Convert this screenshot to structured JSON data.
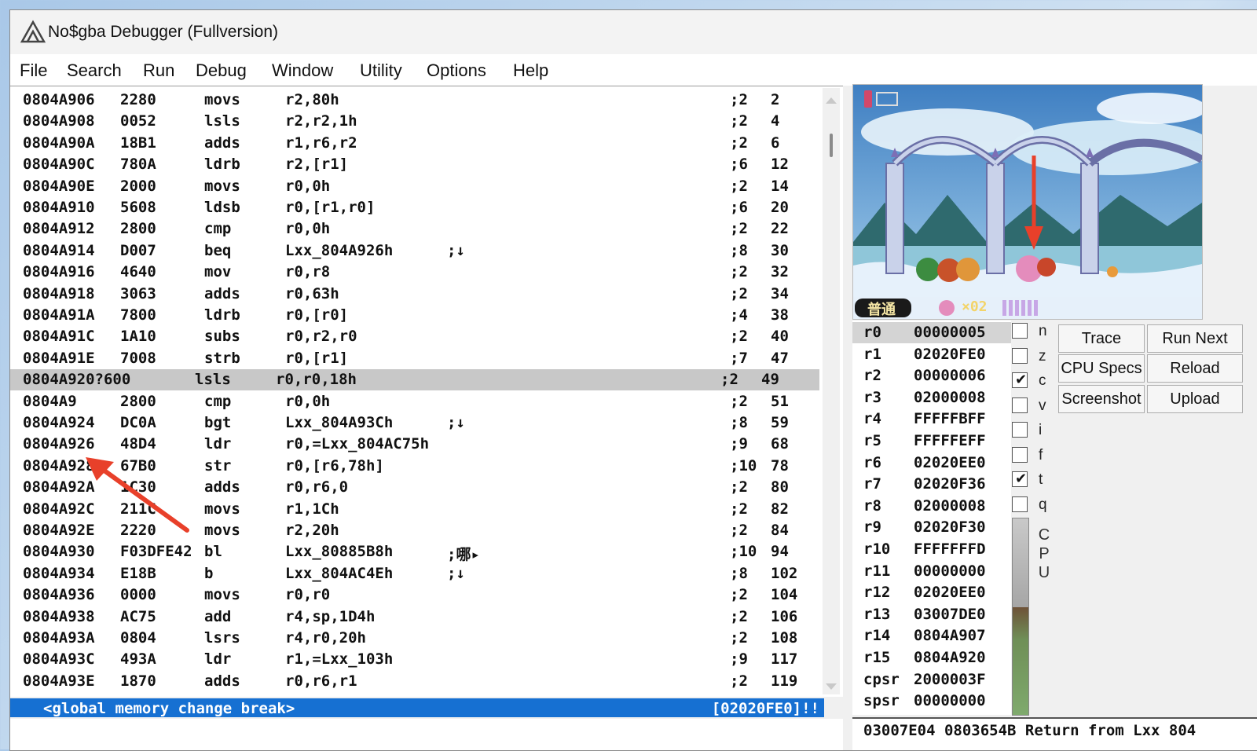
{
  "window": {
    "title": "No$gba Debugger (Fullversion)"
  },
  "menu": [
    "File",
    "Search",
    "Run",
    "Debug",
    "Window",
    "Utility",
    "Options",
    "Help"
  ],
  "disassembly": [
    {
      "addr": "0804A906",
      "op": "2280",
      "mn": "movs",
      "args": "r2,80h",
      "comment": "",
      "cyc": ";2",
      "tot": "2"
    },
    {
      "addr": "0804A908",
      "op": "0052",
      "mn": "lsls",
      "args": "r2,r2,1h",
      "comment": "",
      "cyc": ";2",
      "tot": "4"
    },
    {
      "addr": "0804A90A",
      "op": "18B1",
      "mn": "adds",
      "args": "r1,r6,r2",
      "comment": "",
      "cyc": ";2",
      "tot": "6"
    },
    {
      "addr": "0804A90C",
      "op": "780A",
      "mn": "ldrb",
      "args": "r2,[r1]",
      "comment": "",
      "cyc": ";6",
      "tot": "12"
    },
    {
      "addr": "0804A90E",
      "op": "2000",
      "mn": "movs",
      "args": "r0,0h",
      "comment": "",
      "cyc": ";2",
      "tot": "14"
    },
    {
      "addr": "0804A910",
      "op": "5608",
      "mn": "ldsb",
      "args": "r0,[r1,r0]",
      "comment": "",
      "cyc": ";6",
      "tot": "20"
    },
    {
      "addr": "0804A912",
      "op": "2800",
      "mn": "cmp",
      "args": "r0,0h",
      "comment": "",
      "cyc": ";2",
      "tot": "22"
    },
    {
      "addr": "0804A914",
      "op": "D007",
      "mn": "beq",
      "args": "Lxx_804A926h",
      "comment": ";↓",
      "cyc": ";8",
      "tot": "30"
    },
    {
      "addr": "0804A916",
      "op": "4640",
      "mn": "mov",
      "args": "r0,r8",
      "comment": "",
      "cyc": ";2",
      "tot": "32"
    },
    {
      "addr": "0804A918",
      "op": "3063",
      "mn": "adds",
      "args": "r0,63h",
      "comment": "",
      "cyc": ";2",
      "tot": "34"
    },
    {
      "addr": "0804A91A",
      "op": "7800",
      "mn": "ldrb",
      "args": "r0,[r0]",
      "comment": "",
      "cyc": ";4",
      "tot": "38"
    },
    {
      "addr": "0804A91C",
      "op": "1A10",
      "mn": "subs",
      "args": "r0,r2,r0",
      "comment": "",
      "cyc": ";2",
      "tot": "40"
    },
    {
      "addr": "0804A91E",
      "op": "7008",
      "mn": "strb",
      "args": "r0,[r1]",
      "comment": "",
      "cyc": ";7",
      "tot": "47"
    },
    {
      "addr": "0804A920?600",
      "op": "",
      "mn": "lsls",
      "args": "r0,r0,18h",
      "comment": "",
      "cyc": ";2",
      "tot": "49",
      "selected": true
    },
    {
      "addr": "0804A9",
      "op": "2800",
      "mn": "cmp",
      "args": "r0,0h",
      "comment": "",
      "cyc": ";2",
      "tot": "51"
    },
    {
      "addr": "0804A924",
      "op": "DC0A",
      "mn": "bgt",
      "args": "Lxx_804A93Ch",
      "comment": ";↓",
      "cyc": ";8",
      "tot": "59"
    },
    {
      "addr": "0804A926",
      "op": "48D4",
      "mn": "ldr",
      "args": "r0,=Lxx_804AC75h",
      "comment": "",
      "cyc": ";9",
      "tot": "68"
    },
    {
      "addr": "0804A928",
      "op": "67B0",
      "mn": "str",
      "args": "r0,[r6,78h]",
      "comment": "",
      "cyc": ";10",
      "tot": "78"
    },
    {
      "addr": "0804A92A",
      "op": "1C30",
      "mn": "adds",
      "args": "r0,r6,0",
      "comment": "",
      "cyc": ";2",
      "tot": "80"
    },
    {
      "addr": "0804A92C",
      "op": "211C",
      "mn": "movs",
      "args": "r1,1Ch",
      "comment": "",
      "cyc": ";2",
      "tot": "82"
    },
    {
      "addr": "0804A92E",
      "op": "2220",
      "mn": "movs",
      "args": "r2,20h",
      "comment": "",
      "cyc": ";2",
      "tot": "84"
    },
    {
      "addr": "0804A930",
      "op": "F03DFE42",
      "mn": "bl",
      "args": "Lxx_80885B8h",
      "comment": ";哪▸",
      "cyc": ";10",
      "tot": "94"
    },
    {
      "addr": "0804A934",
      "op": "E18B",
      "mn": "b",
      "args": "Lxx_804AC4Eh",
      "comment": ";↓",
      "cyc": ";8",
      "tot": "102"
    },
    {
      "addr": "0804A936",
      "op": "0000",
      "mn": "movs",
      "args": "r0,r0",
      "comment": "",
      "cyc": ";2",
      "tot": "104"
    },
    {
      "addr": "0804A938",
      "op": "AC75",
      "mn": "add",
      "args": "r4,sp,1D4h",
      "comment": "",
      "cyc": ";2",
      "tot": "106"
    },
    {
      "addr": "0804A93A",
      "op": "0804",
      "mn": "lsrs",
      "args": "r4,r0,20h",
      "comment": "",
      "cyc": ";2",
      "tot": "108"
    },
    {
      "addr": "0804A93C",
      "op": "493A",
      "mn": "ldr",
      "args": "r1,=Lxx_103h",
      "comment": "",
      "cyc": ";9",
      "tot": "117"
    },
    {
      "addr": "0804A93E",
      "op": "1870",
      "mn": "adds",
      "args": "r0,r6,r1",
      "comment": "",
      "cyc": ";2",
      "tot": "119"
    }
  ],
  "status": {
    "message": "<global memory change break>",
    "address": "[02020FE0]!!"
  },
  "game_hud": {
    "mode_label": "普通",
    "lives": "×02"
  },
  "registers": [
    {
      "name": "r0",
      "value": "00000005",
      "selected": true
    },
    {
      "name": "r1",
      "value": "02020FE0"
    },
    {
      "name": "r2",
      "value": "00000006"
    },
    {
      "name": "r3",
      "value": "02000008"
    },
    {
      "name": "r4",
      "value": "FFFFFBFF"
    },
    {
      "name": "r5",
      "value": "FFFFFEFF"
    },
    {
      "name": "r6",
      "value": "02020EE0"
    },
    {
      "name": "r7",
      "value": "02020F36"
    },
    {
      "name": "r8",
      "value": "02000008"
    },
    {
      "name": "r9",
      "value": "02020F30"
    },
    {
      "name": "r10",
      "value": "FFFFFFFD"
    },
    {
      "name": "r11",
      "value": "00000000"
    },
    {
      "name": "r12",
      "value": "02020EE0"
    },
    {
      "name": "r13",
      "value": "03007DE0"
    },
    {
      "name": "r14",
      "value": "0804A907"
    },
    {
      "name": "r15",
      "value": "0804A920"
    },
    {
      "name": "cpsr",
      "value": "2000003F"
    },
    {
      "name": "spsr",
      "value": "00000000"
    }
  ],
  "flags": [
    {
      "name": "n",
      "checked": false
    },
    {
      "name": "z",
      "checked": false
    },
    {
      "name": "c",
      "checked": true
    },
    {
      "name": "v",
      "checked": false
    },
    {
      "name": "i",
      "checked": false
    },
    {
      "name": "f",
      "checked": false
    },
    {
      "name": "t",
      "checked": true
    },
    {
      "name": "q",
      "checked": false
    }
  ],
  "cpu_meter": {
    "label_letters": [
      "C",
      "P",
      "U"
    ],
    "load_fraction": 0.55
  },
  "buttons": {
    "trace": "Trace",
    "run_next": "Run Next",
    "cpu_specs": "CPU Specs",
    "reload": "Reload",
    "screenshot": "Screenshot",
    "upload": "Upload"
  },
  "stack": {
    "line": "03007E04 0803654B Return from Lxx 804"
  },
  "colors": {
    "status_bar": "#1670d2",
    "annotation_arrow": "#e8402a",
    "selection": "#c8c8c8"
  }
}
